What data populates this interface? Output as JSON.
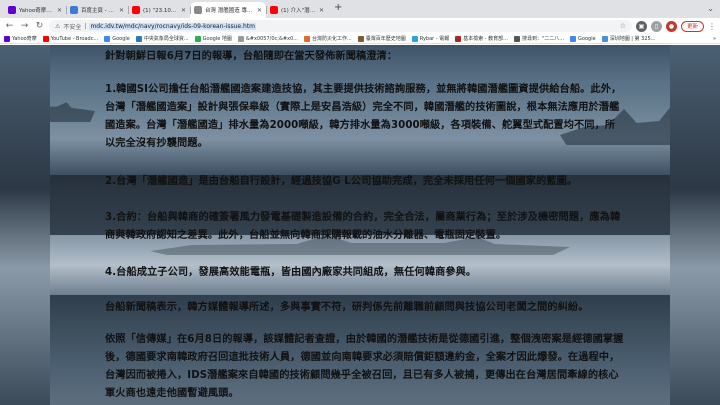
{
  "browser": {
    "tabs": [
      {
        "title": "Yahoo奇摩新聞",
        "color": "#6001d2"
      },
      {
        "title": "百度主頁 - Mobile01",
        "color": "#3a7bd5"
      },
      {
        "title": "(1) \"23.10.05【新聞】正視國防...",
        "color": "#ff0000"
      },
      {
        "title": "台灣 潛艦國造 專案計畫 IDS IDS...",
        "color": "#888888"
      },
      {
        "title": "(1) 介入\"潛艦國造\"遭起重遇到...",
        "color": "#ff0000"
      }
    ],
    "new_tab": "+",
    "url_prefix": "不安全",
    "url": "mdc.idv.tw/mdc/navy/rocnavy/ids-09-korean-issue.htm",
    "update_label": "更新",
    "bookmarks": [
      {
        "label": "Yahoo奇摩",
        "color": "#6001d2"
      },
      {
        "label": "YouTube - Broadc...",
        "color": "#ff0000"
      },
      {
        "label": "Google",
        "color": "#4285f4"
      },
      {
        "label": "中央氣象局全球資...",
        "color": "#2a7ab8"
      },
      {
        "label": "Google 地圖",
        "color": "#34a853"
      },
      {
        "label": "&#x0057/0c;&#x0...",
        "color": "#999999"
      },
      {
        "label": "台灣防災化工作...",
        "color": "#e06b2a"
      },
      {
        "label": "臺灣百年歷史地圖",
        "color": "#7a5c2e"
      },
      {
        "label": "Rybar - 電報",
        "color": "#2aa3d9"
      },
      {
        "label": "基本檢索 - 教育部...",
        "color": "#b22222"
      },
      {
        "label": "搜尋到：\"二二八...",
        "color": "#555555"
      },
      {
        "label": "Google",
        "color": "#4285f4"
      },
      {
        "label": "深圳地圖 | 第 325...",
        "color": "#4a90d9"
      }
    ],
    "bookmarks_more": "»"
  },
  "article": {
    "p0": "針對朝鮮日報6月7日的報導，台船隨即在當天發佈新聞稿澄清：",
    "p1": "1.韓國SI公司擔任台船潛艦國造案建造技協，其主要提供技術諮詢服務，並無將韓國潛艦圖資提供給台船。此外，台灣「潛艦國造案」設計與張保皋級（實際上是安昌浩級）完全不同，韓國潛艦的技術圖說，根本無法應用於潛艦國造案。台灣「潛艦國造」排水量為2000噸級，韓方排水量為3000噸級，各項裝備、舵翼型式配置均不同，所以完全沒有抄襲問題。",
    "p2": "2.台灣「潛艦國造」是由台船自行設計，經過技協G L公司協助完成，完全未採用任何一個國家的藍圖。",
    "p3": "3.合約：台船與韓商的確簽署風力發電基礎製造設備的合約，完全合法，屬商業行為；至於涉及機密問題，應為韓商與韓政府認知之差異。此外，台船並無向韓商採購報載的油水分離器、電瓶固定裝置。",
    "p4": "4.台船成立子公司，發展高效能電瓶，皆由國內廠家共同組成，無任何韓商參與。",
    "p5": "台船新聞稿表示，韓方媒體報導所述，多與事實不符，研判係先前離職前顧問與技協公司老闆之間的糾紛。",
    "p6": "依照「信傳媒」在6月8日的報導，該媒體記者查證，由於韓國的潛艦技術是從德國引進，整個洩密案是經德國掌握後，德國要求南韓政府召回這批技術人員，德國並向南韓要求必須賠償鉅額違約金，全案才因此爆發。在過程中，台灣因而被捲入，IDS潛艦案來自韓國的技術顧問幾乎全被召回，且已有多人被捕，更傳出在台灣居間牽線的核心軍火商也遠走他國暫避風頭。"
  }
}
